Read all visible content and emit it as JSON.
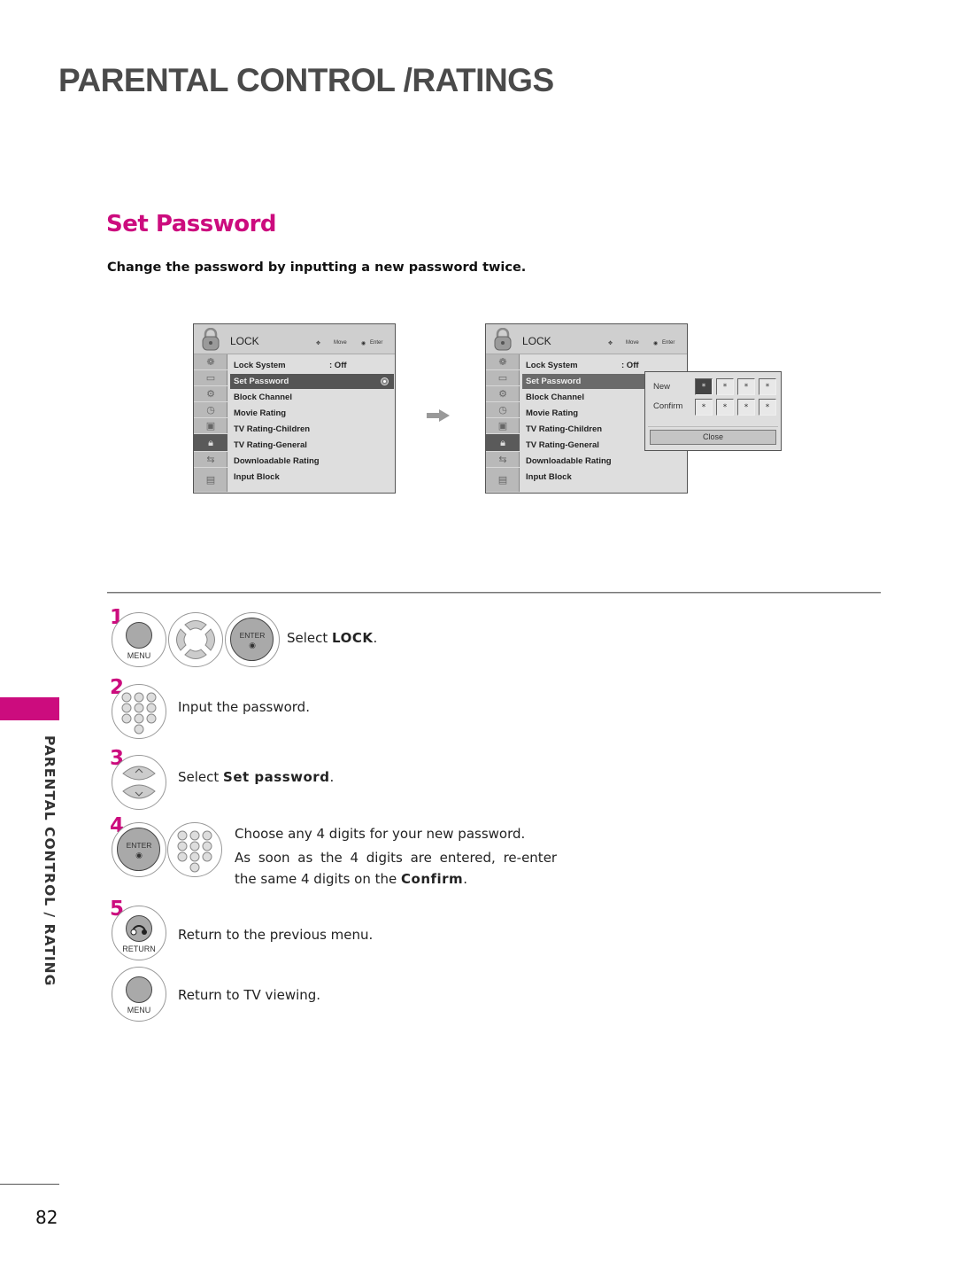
{
  "page": {
    "title": "PARENTAL CONTROL /RATINGS",
    "section_title": "Set Password",
    "subtitle": "Change the password by inputting a new password twice.",
    "side_label": "PARENTAL CONTROL / RATING",
    "page_number": "82",
    "accent_color": "#cc0c7e"
  },
  "menu": {
    "title": "LOCK",
    "hint_move": "Move",
    "hint_enter": "Enter",
    "side_icons": [
      "picture-icon",
      "screen-icon",
      "option-icon",
      "clock-icon",
      "audio-icon",
      "lock-icon",
      "input-icon",
      "usb-icon"
    ],
    "items": [
      {
        "label": "Lock System",
        "value": ": Off"
      },
      {
        "label": "Set Password",
        "value": ""
      },
      {
        "label": "Block Channel",
        "value": ""
      },
      {
        "label": "Movie Rating",
        "value": ""
      },
      {
        "label": "TV Rating-Children",
        "value": ""
      },
      {
        "label": "TV Rating-General",
        "value": ""
      },
      {
        "label": "Downloadable Rating",
        "value": ""
      },
      {
        "label": "Input Block",
        "value": ""
      }
    ],
    "selected_index": 1
  },
  "popup": {
    "new_label": "New",
    "confirm_label": "Confirm",
    "mask_char": "*",
    "close_label": "Close"
  },
  "steps": [
    {
      "num": "1",
      "text_prefix": "Select ",
      "text_bold": "LOCK",
      "text_suffix": ".",
      "buttons": [
        "MENU",
        "",
        "ENTER"
      ]
    },
    {
      "num": "2",
      "text": "Input the password."
    },
    {
      "num": "3",
      "text_prefix": "Select ",
      "text_bold": "Set password",
      "text_suffix": "."
    },
    {
      "num": "4",
      "line1": "Choose any 4 digits for your new password.",
      "line2": "As soon as the 4 digits are entered, re-enter",
      "line3_prefix": "the same 4 digits on the ",
      "line3_bold": "Confirm",
      "line3_suffix": ".",
      "buttons": [
        "ENTER"
      ]
    },
    {
      "num": "5",
      "text": "Return to the previous menu.",
      "buttons": [
        "RETURN"
      ]
    },
    {
      "num": "",
      "text": "Return to TV viewing.",
      "buttons": [
        "MENU"
      ]
    }
  ]
}
